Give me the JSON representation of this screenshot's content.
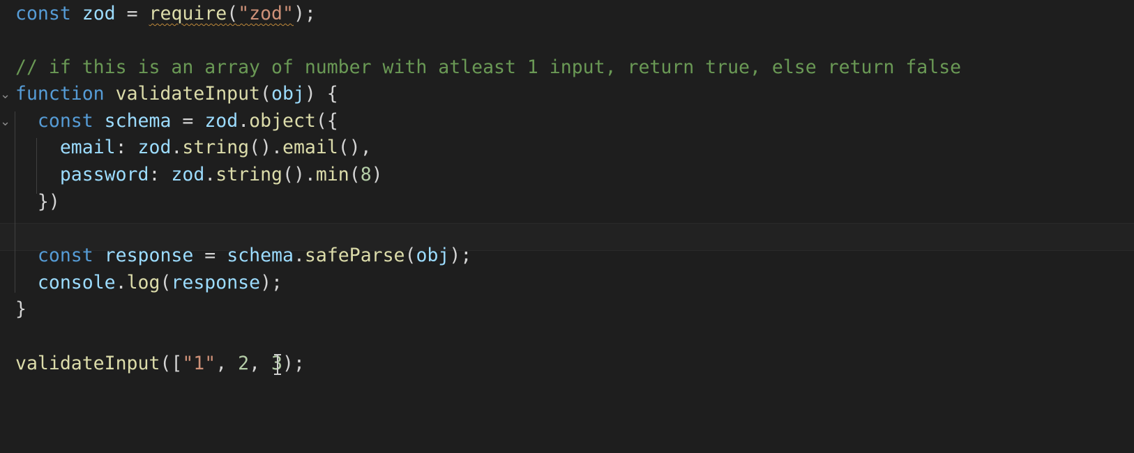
{
  "editor": {
    "lines": {
      "l1": [
        "const",
        "zod",
        "=",
        "require",
        "(",
        "\"zod\"",
        ");"
      ],
      "l3": "// if this is an array of number with atleast 1 input, return true, else return false",
      "l4": [
        "function",
        "validateInput",
        "(",
        "obj",
        ") {"
      ],
      "l5": [
        "const",
        "schema",
        "=",
        "zod",
        ".",
        "object",
        "({"
      ],
      "l6": [
        "email",
        ":",
        "zod",
        ".",
        "string",
        "().",
        "email",
        "(),"
      ],
      "l7": [
        "password",
        ":",
        "zod",
        ".",
        "string",
        "().",
        "min",
        "(",
        "8",
        ")"
      ],
      "l8": "})",
      "l10": [
        "const",
        "response",
        "=",
        "schema",
        ".",
        "safeParse",
        "(",
        "obj",
        ");"
      ],
      "l11": [
        "console",
        ".",
        "log",
        "(",
        "response",
        ");"
      ],
      "l12": "}",
      "l14": [
        "validateInput",
        "([",
        "\"1\"",
        ", ",
        "2",
        ", ",
        "3",
        ");"
      ]
    },
    "fold_glyph": "⌄",
    "colors": {
      "background": "#1e1e1e",
      "keyword": "#569cd6",
      "variable": "#9cdcfe",
      "function": "#dcdcaa",
      "string": "#ce9178",
      "number": "#b5cea8",
      "comment": "#6a9955"
    }
  }
}
